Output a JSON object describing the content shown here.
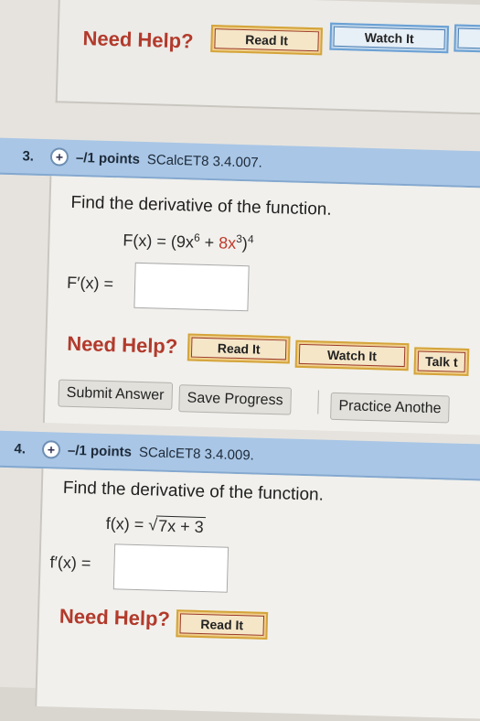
{
  "top_card": {
    "need_help": "Need Help?",
    "read_it": "Read It",
    "watch_it": "Watch It"
  },
  "q3": {
    "number": "3.",
    "points": "–/1 points",
    "code": "SCalcET8 3.4.007.",
    "prompt": "Find the derivative of the function.",
    "func_lhs": "F(x) = (9x",
    "func_exp1": "6",
    "func_plus": " + ",
    "func_term2": "8x",
    "func_exp2": "3",
    "func_close": ")",
    "func_exp3": "4",
    "answer_label": "F′(x) =",
    "answer_value": "",
    "need_help": "Need Help?",
    "read_it": "Read It",
    "watch_it": "Watch It",
    "talk": "Talk t",
    "submit": "Submit Answer",
    "save": "Save Progress",
    "practice": "Practice Anothe"
  },
  "q4": {
    "number": "4.",
    "points": "–/1 points",
    "code": "SCalcET8 3.4.009.",
    "prompt": "Find the derivative of the function.",
    "func_lhs": "f(x) = ",
    "radicand": "7x + 3",
    "answer_label": "f′(x) =",
    "answer_value": "",
    "need_help": "Need Help?",
    "read_it": "Read It"
  },
  "colors": {
    "need_help": "#b23a2c",
    "question_bar": "#a9c6e6",
    "red_button_border": "#d4a43a",
    "blue_button_border": "#6aa0d4"
  }
}
